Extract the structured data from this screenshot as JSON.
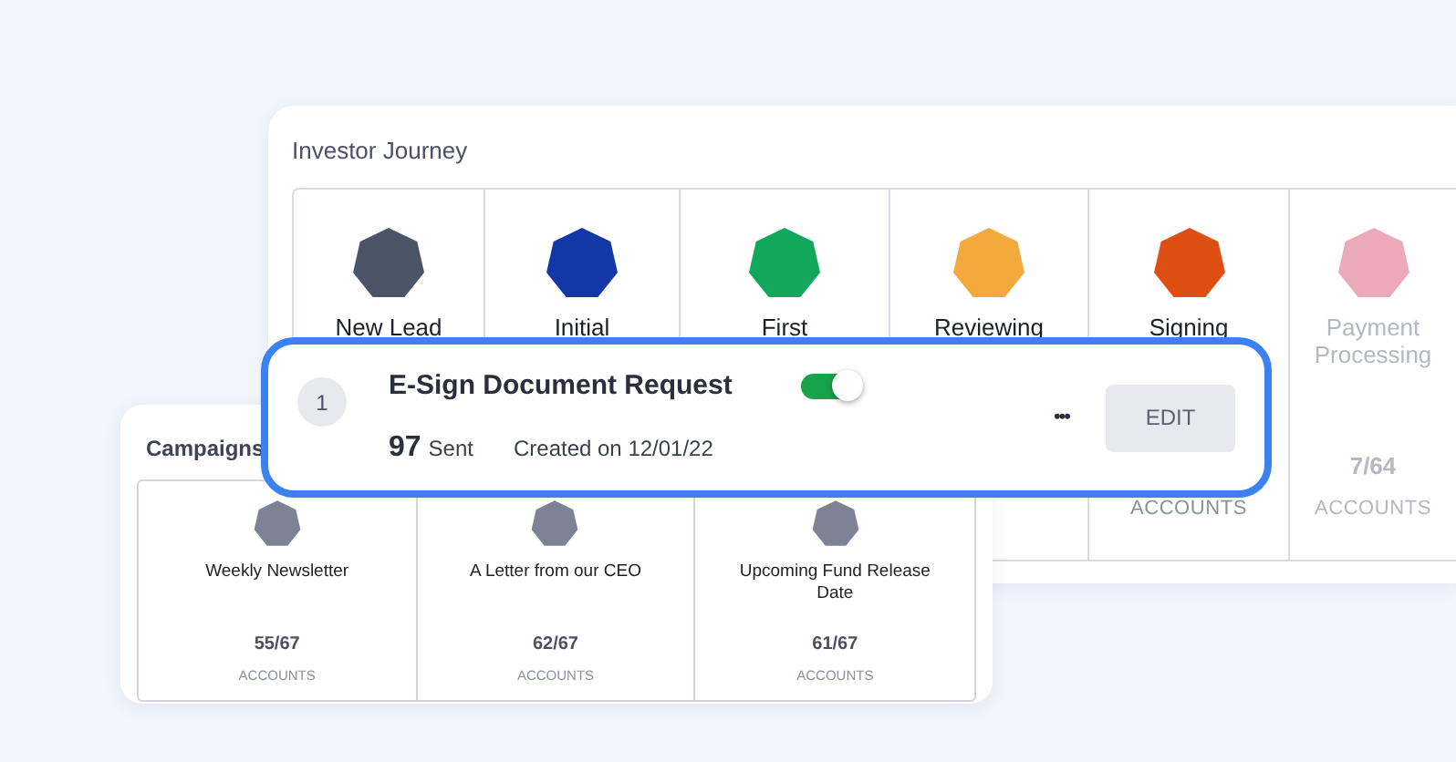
{
  "journey": {
    "title": "Investor Journey",
    "stages": [
      {
        "name": "New Lead",
        "color": "#4b5567",
        "faded": false
      },
      {
        "name": "Initial",
        "color": "#1238a8",
        "faded": false
      },
      {
        "name": "First",
        "color": "#12a85c",
        "faded": false
      },
      {
        "name": "Reviewing",
        "color": "#f2aa3c",
        "faded": false
      },
      {
        "name": "Signing",
        "color": "#df4f14",
        "unit": "ACCOUNTS",
        "faded": false
      },
      {
        "name": "Payment Processing",
        "color": "#ebaab9",
        "count": "7/64",
        "unit": "ACCOUNTS",
        "faded": true
      }
    ]
  },
  "campaigns": {
    "title": "Campaigns",
    "items": [
      {
        "name": "Weekly Newsletter",
        "count": "55/67",
        "unit": "ACCOUNTS"
      },
      {
        "name": "A Letter from our CEO",
        "count": "62/67",
        "unit": "ACCOUNTS"
      },
      {
        "name": "Upcoming Fund Release Date",
        "count": "61/67",
        "unit": "ACCOUNTS"
      }
    ]
  },
  "step": {
    "number": "1",
    "title": "E-Sign Document Request",
    "on": true,
    "sent_count": "97",
    "sent_label": "Sent",
    "created": "Created on 12/01/22",
    "more": "•••",
    "button": "EDIT"
  }
}
